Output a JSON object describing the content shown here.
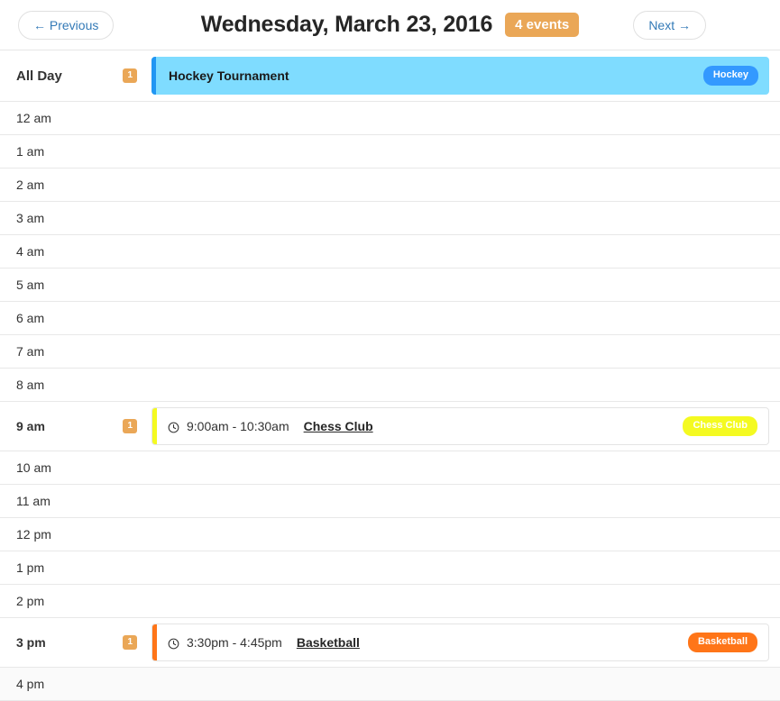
{
  "header": {
    "prev_label": "← Previous",
    "next_label": "Next →",
    "title": "Wednesday, March 23, 2016",
    "events_badge": "4 events",
    "badge_color": "#eaa757",
    "link_color": "#337ab7"
  },
  "allday": {
    "label": "All Day",
    "count": "1",
    "event": {
      "title": "Hockey Tournament",
      "tag": "Hockey",
      "accent_color": "#2196f3",
      "background": "#7fdcff",
      "tag_color": "#3399ff"
    }
  },
  "rows": [
    {
      "hour": "12 am",
      "count": null,
      "event": null
    },
    {
      "hour": "1 am",
      "count": null,
      "event": null
    },
    {
      "hour": "2 am",
      "count": null,
      "event": null
    },
    {
      "hour": "3 am",
      "count": null,
      "event": null
    },
    {
      "hour": "4 am",
      "count": null,
      "event": null
    },
    {
      "hour": "5 am",
      "count": null,
      "event": null
    },
    {
      "hour": "6 am",
      "count": null,
      "event": null
    },
    {
      "hour": "7 am",
      "count": null,
      "event": null
    },
    {
      "hour": "8 am",
      "count": null,
      "event": null
    },
    {
      "hour": "9 am",
      "count": "1",
      "event": {
        "time": "9:00am - 10:30am",
        "title": "Chess Club",
        "tag": "Chess Club",
        "accent_color": "#f4fa21",
        "tag_color": "#f4fa21",
        "icon": "clock-icon"
      }
    },
    {
      "hour": "10 am",
      "count": null,
      "event": null
    },
    {
      "hour": "11 am",
      "count": null,
      "event": null
    },
    {
      "hour": "12 pm",
      "count": null,
      "event": null
    },
    {
      "hour": "1 pm",
      "count": null,
      "event": null
    },
    {
      "hour": "2 pm",
      "count": null,
      "event": null
    },
    {
      "hour": "3 pm",
      "count": "1",
      "event": {
        "time": "3:30pm - 4:45pm",
        "title": "Basketball",
        "tag": "Basketball",
        "accent_color": "#ff7518",
        "tag_color": "#ff7518",
        "icon": "clock-icon"
      }
    },
    {
      "hour": "4 pm",
      "count": null,
      "event": null,
      "hovered": true
    }
  ]
}
